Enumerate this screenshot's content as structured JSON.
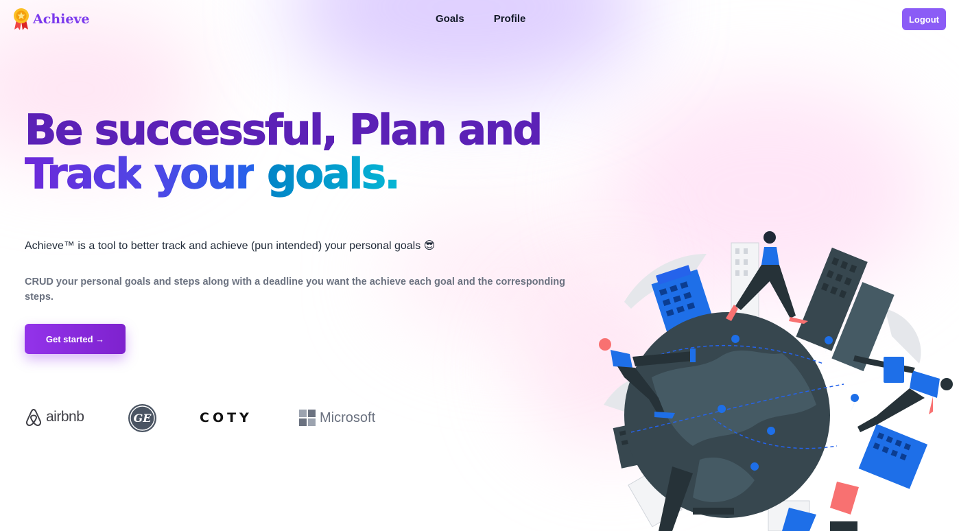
{
  "brand": {
    "name": "Achieve",
    "logo_icon": "ribbon-medal-icon"
  },
  "nav": {
    "links": [
      {
        "label": "Goals"
      },
      {
        "label": "Profile"
      }
    ],
    "logout_label": "Logout"
  },
  "hero": {
    "headline_line1": "Be successful, Plan and",
    "headline_word_track": "Track",
    "headline_word_your": "your",
    "headline_word_goals": "goals.",
    "intro": "Achieve™ is a tool to better track and achieve (pun intended) your personal goals 😎",
    "description": "CRUD your personal goals and steps along with a deadline you want the achieve each goal and the corresponding steps.",
    "cta_label": "Get started →"
  },
  "logos": [
    {
      "name": "airbnb",
      "text": "airbnb",
      "icon": "airbnb-icon"
    },
    {
      "name": "General Electric",
      "text": "GE",
      "icon": "ge-monogram-icon"
    },
    {
      "name": "coty",
      "text": "COTY"
    },
    {
      "name": "microsoft",
      "text": "Microsoft",
      "icon": "microsoft-windows-icon"
    }
  ],
  "colors": {
    "accent": "#8b5cf6",
    "brand_purple": "#7c3aed",
    "headline_purple": "#5b21b6",
    "gradient_blue": "#2563eb",
    "gradient_cyan": "#06b6d4",
    "globe": "#37474f",
    "building_blue": "#1e6fe8"
  },
  "illustration": {
    "icon": "globe-people-illustration"
  }
}
